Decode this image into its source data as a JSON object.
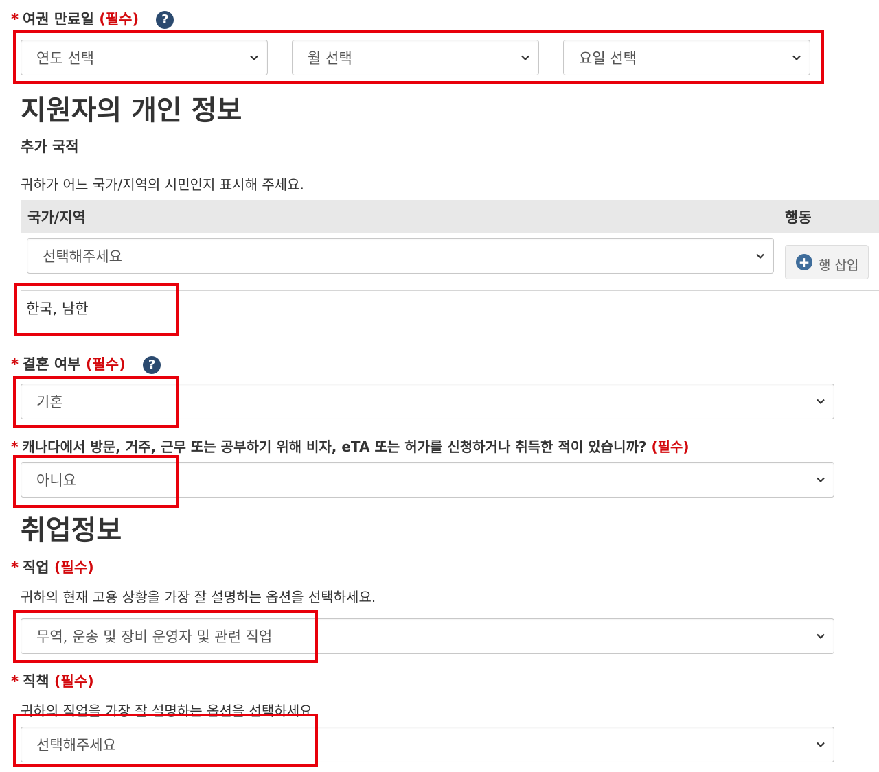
{
  "passport_expiry": {
    "label": "여권 만료일",
    "required": "(필수)",
    "year_value": "연도 선택",
    "month_value": "월 선택",
    "day_value": "요일 선택"
  },
  "applicant_section": {
    "heading": "지원자의 개인 정보"
  },
  "additional_citizenship": {
    "label": "추가 국적",
    "help": "귀하가 어느 국가/지역의 시민인지 표시해 주세요.",
    "col_country": "국가/지역",
    "col_action": "행동",
    "select_value": "선택해주세요",
    "insert_label": "행 삽입",
    "row_country": "한국, 남한"
  },
  "marital_status": {
    "label": "결혼 여부",
    "required": "(필수)",
    "value": "기혼"
  },
  "visa_history": {
    "label": "캐나다에서 방문, 거주, 근무 또는 공부하기 위해 비자, eTA 또는 허가를 신청하거나 취득한 적이 있습니까?",
    "required": "(필수)",
    "value": "아니요"
  },
  "employment_section": {
    "heading": "취업정보"
  },
  "occupation": {
    "label": "직업",
    "required": "(필수)",
    "help": "귀하의 현재 고용 상황을 가장 잘 설명하는 옵션을 선택하세요.",
    "value": "무역, 운송 및 장비 운영자 및 관련 직업"
  },
  "job_title": {
    "label": "직책",
    "required": "(필수)",
    "help": "귀하의 직업을 가장 잘 설명하는 옵션을 선택하세요.",
    "value": "선택해주세요"
  },
  "symbols": {
    "star": "*",
    "question": "?",
    "plus": "+"
  },
  "icons": [
    "help-icon",
    "chevron-down-icon",
    "plus-circle-icon"
  ],
  "colors": {
    "required_red": "#d3080c",
    "highlight_red": "#e8000b",
    "help_icon": "#2b4a6f",
    "table_header": "#e8e8e8"
  }
}
